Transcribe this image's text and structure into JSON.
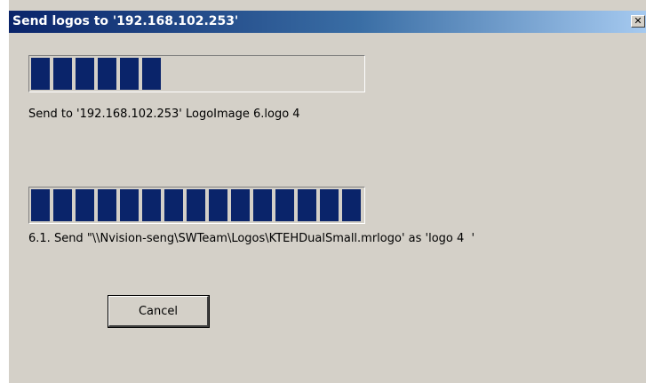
{
  "dialog": {
    "title": "Send logos to '192.168.102.253'",
    "close_label": "✕"
  },
  "progress_overall": {
    "fraction": 0.4
  },
  "status_overall": "Send to '192.168.102.253' LogoImage 6.logo 4",
  "progress_file": {
    "fraction": 1.0
  },
  "status_file": "6.1. Send \"\\\\Nvision-seng\\SWTeam\\Logos\\KTEHDualSmall.mrlogo' as 'logo 4  '",
  "buttons": {
    "cancel": "Cancel"
  },
  "colors": {
    "progress_fill": "#0a246a",
    "title_bar": "#0a246a",
    "dialog_background": "#d4d0c8"
  }
}
